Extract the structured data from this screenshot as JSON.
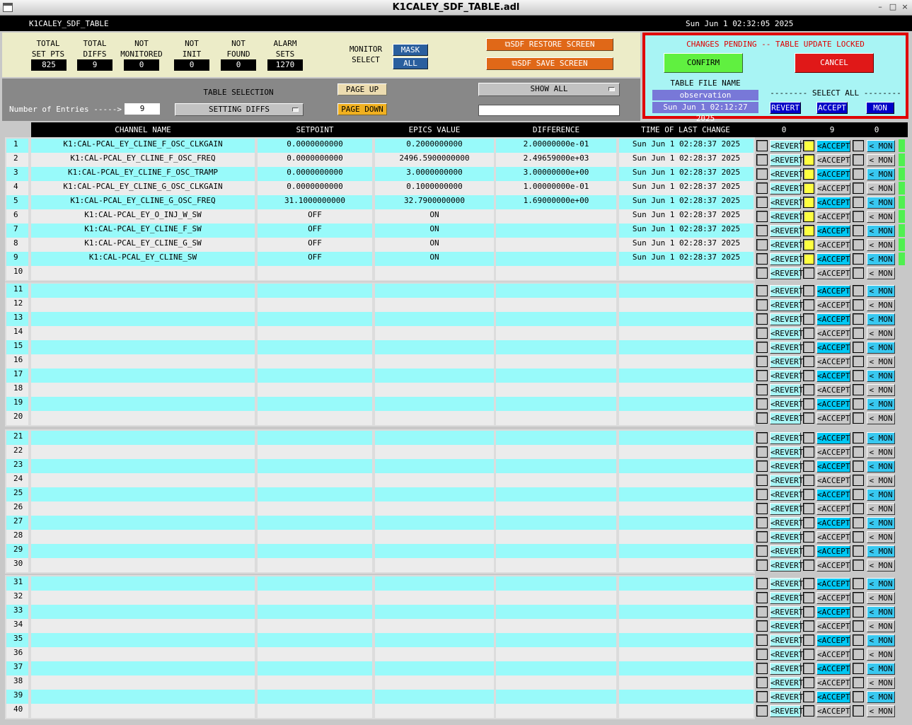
{
  "window": {
    "title": "K1CALEY_SDF_TABLE.adl",
    "controls": [
      "–",
      "□",
      "×"
    ]
  },
  "header": {
    "screen_name": "K1CALEY_SDF_TABLE",
    "datetime": "Sun Jun  1 02:32:05 2025"
  },
  "stats": [
    {
      "label1": "TOTAL",
      "label2": "SET PTS",
      "value": "825"
    },
    {
      "label1": "TOTAL",
      "label2": "DIFFS",
      "value": "9"
    },
    {
      "label1": "NOT",
      "label2": "MONITORED",
      "value": "0"
    },
    {
      "label1": "NOT",
      "label2": "INIT",
      "value": "0"
    },
    {
      "label1": "NOT",
      "label2": "FOUND",
      "value": "0"
    },
    {
      "label1": "ALARM",
      "label2": "SETS",
      "value": "1270"
    }
  ],
  "monitor_select": {
    "label1": "MONITOR",
    "label2": "SELECT",
    "mask": "MASK",
    "all": "ALL"
  },
  "sdf": {
    "restore": "SDF RESTORE SCREEN",
    "save": "SDF SAVE SCREEN"
  },
  "controls": {
    "entries_label": "Number of Entries ----->",
    "entries_value": "9",
    "table_selection_label": "TABLE SELECTION",
    "table_selection_value": "SETTING DIFFS",
    "page_up": "PAGE UP",
    "page_down": "PAGE DOWN",
    "show_all": "SHOW ALL",
    "filter_value": ""
  },
  "pending": {
    "message": "CHANGES PENDING -- TABLE UPDATE LOCKED",
    "confirm": "CONFIRM",
    "cancel": "CANCEL",
    "table_file_label": "TABLE FILE NAME",
    "table_file_value": "observation",
    "table_file_time": "Sun Jun  1 02:12:27 2025",
    "select_all_label": "-------- SELECT ALL --------",
    "revert": "REVERT",
    "accept": "ACCEPT",
    "mon": "MON"
  },
  "table": {
    "columns": [
      "CHANNEL NAME",
      "SETPOINT",
      "EPICS VALUE",
      "DIFFERENCE",
      "TIME OF LAST CHANGE"
    ],
    "counts": [
      "0",
      "9",
      "0"
    ],
    "revert_label": "<REVERT",
    "accept_label": "<ACCEPT",
    "mon_label": "< MON",
    "rows": [
      {
        "idx": "1",
        "name": "K1:CAL-PCAL_EY_CLINE_F_OSC_CLKGAIN",
        "setpoint": "0.0000000000",
        "epics": "0.2000000000",
        "diff": "2.00000000e-01",
        "time": "Sun Jun  1 02:28:37 2025"
      },
      {
        "idx": "2",
        "name": "K1:CAL-PCAL_EY_CLINE_F_OSC_FREQ",
        "setpoint": "0.0000000000",
        "epics": "2496.5900000000",
        "diff": "2.49659000e+03",
        "time": "Sun Jun  1 02:28:37 2025"
      },
      {
        "idx": "3",
        "name": "K1:CAL-PCAL_EY_CLINE_F_OSC_TRAMP",
        "setpoint": "0.0000000000",
        "epics": "3.0000000000",
        "diff": "3.00000000e+00",
        "time": "Sun Jun  1 02:28:37 2025"
      },
      {
        "idx": "4",
        "name": "K1:CAL-PCAL_EY_CLINE_G_OSC_CLKGAIN",
        "setpoint": "0.0000000000",
        "epics": "0.1000000000",
        "diff": "1.00000000e-01",
        "time": "Sun Jun  1 02:28:37 2025"
      },
      {
        "idx": "5",
        "name": "K1:CAL-PCAL_EY_CLINE_G_OSC_FREQ",
        "setpoint": "31.1000000000",
        "epics": "32.7900000000",
        "diff": "1.69000000e+00",
        "time": "Sun Jun  1 02:28:37 2025"
      },
      {
        "idx": "6",
        "name": "K1:CAL-PCAL_EY_O_INJ_W_SW",
        "setpoint": "OFF",
        "epics": "ON",
        "diff": "",
        "time": "Sun Jun  1 02:28:37 2025"
      },
      {
        "idx": "7",
        "name": "K1:CAL-PCAL_EY_CLINE_F_SW",
        "setpoint": "OFF",
        "epics": "ON",
        "diff": "",
        "time": "Sun Jun  1 02:28:37 2025"
      },
      {
        "idx": "8",
        "name": "K1:CAL-PCAL_EY_CLINE_G_SW",
        "setpoint": "OFF",
        "epics": "ON",
        "diff": "",
        "time": "Sun Jun  1 02:28:37 2025"
      },
      {
        "idx": "9",
        "name": "K1:CAL-PCAL_EY_CLINE_SW",
        "setpoint": "OFF",
        "epics": "ON",
        "diff": "",
        "time": "Sun Jun  1 02:28:37 2025"
      },
      {
        "idx": "10",
        "name": "",
        "setpoint": "",
        "epics": "",
        "diff": "",
        "time": ""
      },
      {
        "idx": "11"
      },
      {
        "idx": "12"
      },
      {
        "idx": "13"
      },
      {
        "idx": "14"
      },
      {
        "idx": "15"
      },
      {
        "idx": "16"
      },
      {
        "idx": "17"
      },
      {
        "idx": "18"
      },
      {
        "idx": "19"
      },
      {
        "idx": "20"
      },
      {
        "idx": "21"
      },
      {
        "idx": "22"
      },
      {
        "idx": "23"
      },
      {
        "idx": "24"
      },
      {
        "idx": "25"
      },
      {
        "idx": "26"
      },
      {
        "idx": "27"
      },
      {
        "idx": "28"
      },
      {
        "idx": "29"
      },
      {
        "idx": "30"
      },
      {
        "idx": "31"
      },
      {
        "idx": "32"
      },
      {
        "idx": "33"
      },
      {
        "idx": "34"
      },
      {
        "idx": "35"
      },
      {
        "idx": "36"
      },
      {
        "idx": "37"
      },
      {
        "idx": "38"
      },
      {
        "idx": "39"
      },
      {
        "idx": "40"
      }
    ]
  }
}
